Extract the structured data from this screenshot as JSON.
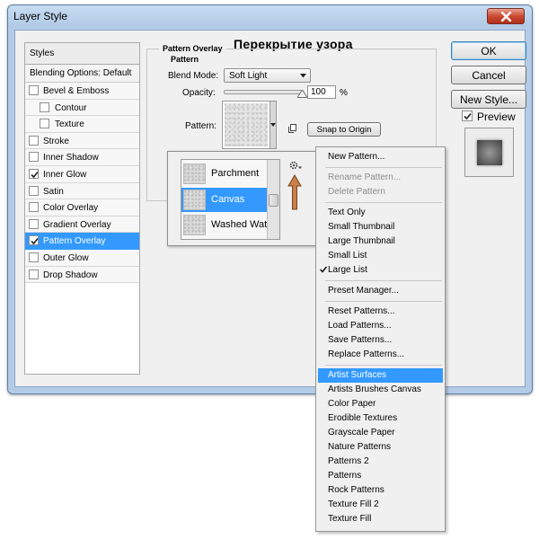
{
  "window": {
    "title": "Layer Style",
    "overlay_title": "Перекрытие узора"
  },
  "styles": {
    "header": "Styles",
    "blending_default": "Blending Options: Default",
    "items": [
      {
        "label": "Bevel & Emboss",
        "checked": false,
        "sub": false,
        "selected": false
      },
      {
        "label": "Contour",
        "checked": false,
        "sub": true,
        "selected": false
      },
      {
        "label": "Texture",
        "checked": false,
        "sub": true,
        "selected": false
      },
      {
        "label": "Stroke",
        "checked": false,
        "sub": false,
        "selected": false
      },
      {
        "label": "Inner Shadow",
        "checked": false,
        "sub": false,
        "selected": false
      },
      {
        "label": "Inner Glow",
        "checked": true,
        "sub": false,
        "selected": false
      },
      {
        "label": "Satin",
        "checked": false,
        "sub": false,
        "selected": false
      },
      {
        "label": "Color Overlay",
        "checked": false,
        "sub": false,
        "selected": false
      },
      {
        "label": "Gradient Overlay",
        "checked": false,
        "sub": false,
        "selected": false
      },
      {
        "label": "Pattern Overlay",
        "checked": true,
        "sub": false,
        "selected": true
      },
      {
        "label": "Outer Glow",
        "checked": false,
        "sub": false,
        "selected": false
      },
      {
        "label": "Drop Shadow",
        "checked": false,
        "sub": false,
        "selected": false
      }
    ]
  },
  "pattern_overlay": {
    "group_title": "Pattern Overlay",
    "group_subtitle": "Pattern",
    "blend_mode_label": "Blend Mode:",
    "blend_mode_value": "Soft Light",
    "opacity_label": "Opacity:",
    "opacity_value": "100",
    "opacity_unit": "%",
    "opacity_level": 1.0,
    "pattern_label": "Pattern:",
    "snap_button": "Snap to Origin"
  },
  "buttons": {
    "ok": "OK",
    "cancel": "Cancel",
    "new_style": "New Style...",
    "preview_label": "Preview",
    "preview_checked": true
  },
  "picker": {
    "items": [
      {
        "name": "Parchment",
        "selected": false
      },
      {
        "name": "Canvas",
        "selected": true
      },
      {
        "name": "Washed Wate",
        "selected": false
      }
    ]
  },
  "menu": {
    "groups": [
      [
        {
          "label": "New Pattern...",
          "disabled": false
        }
      ],
      [
        {
          "label": "Rename Pattern...",
          "disabled": true
        },
        {
          "label": "Delete Pattern",
          "disabled": true
        }
      ],
      [
        {
          "label": "Text Only",
          "disabled": false
        },
        {
          "label": "Small Thumbnail",
          "disabled": false
        },
        {
          "label": "Large Thumbnail",
          "disabled": false
        },
        {
          "label": "Small List",
          "disabled": false
        },
        {
          "label": "Large List",
          "disabled": false,
          "checked": true
        }
      ],
      [
        {
          "label": "Preset Manager...",
          "disabled": false
        }
      ],
      [
        {
          "label": "Reset Patterns...",
          "disabled": false
        },
        {
          "label": "Load Patterns...",
          "disabled": false
        },
        {
          "label": "Save Patterns...",
          "disabled": false
        },
        {
          "label": "Replace Patterns...",
          "disabled": false
        }
      ],
      [
        {
          "label": "Artist Surfaces",
          "disabled": false,
          "hover": true
        },
        {
          "label": "Artists Brushes Canvas",
          "disabled": false
        },
        {
          "label": "Color Paper",
          "disabled": false
        },
        {
          "label": "Erodible Textures",
          "disabled": false
        },
        {
          "label": "Grayscale Paper",
          "disabled": false
        },
        {
          "label": "Nature Patterns",
          "disabled": false
        },
        {
          "label": "Patterns 2",
          "disabled": false
        },
        {
          "label": "Patterns",
          "disabled": false
        },
        {
          "label": "Rock Patterns",
          "disabled": false
        },
        {
          "label": "Texture Fill 2",
          "disabled": false
        },
        {
          "label": "Texture Fill",
          "disabled": false
        }
      ]
    ]
  },
  "colors": {
    "selection": "#3399ff",
    "annotation_arrow": "#c87f4a",
    "close_button": "#c84a30"
  },
  "icons": {
    "close": "close-icon",
    "dropdown": "chevron-down-icon",
    "gear": "gear-icon",
    "new_preset": "new-preset-icon",
    "annotation": "arrow-up-icon",
    "check": "checkmark-icon"
  }
}
